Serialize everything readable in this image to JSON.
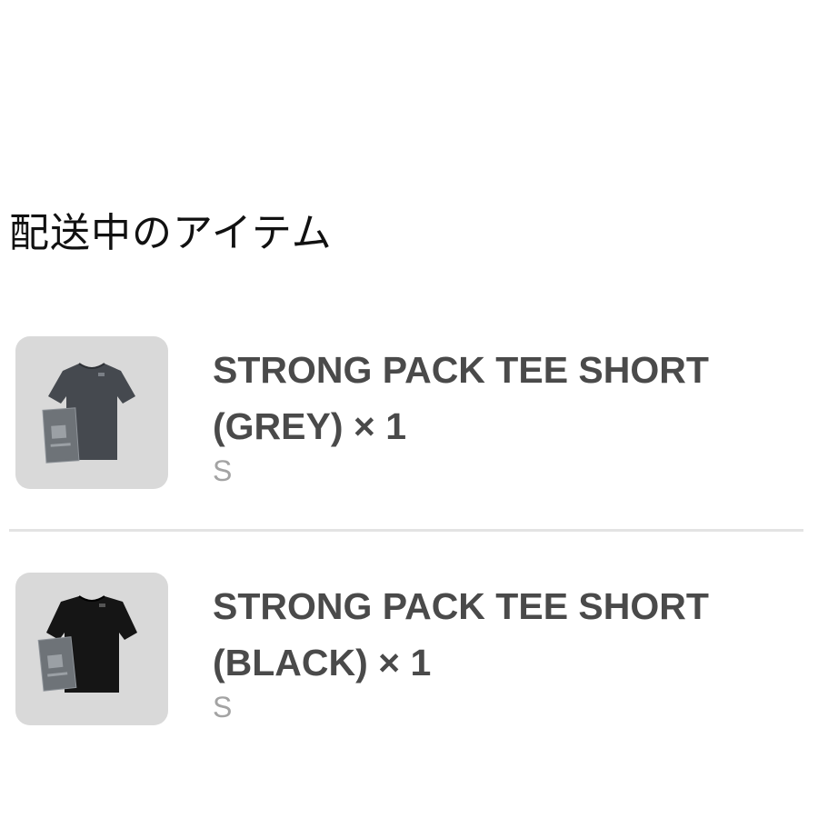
{
  "section": {
    "title": "配送中のアイテム"
  },
  "items": [
    {
      "name_line1": "STRONG PACK TEE SHORT",
      "name_line2": "(GREY) × 1",
      "option": "S",
      "thumbnail_icon": "grey-tshirt-thumbnail",
      "shirt_color": "#45494f"
    },
    {
      "name_line1": "STRONG PACK TEE SHORT",
      "name_line2": "(BLACK) × 1",
      "option": "S",
      "thumbnail_icon": "black-tshirt-thumbnail",
      "shirt_color": "#151515"
    }
  ],
  "colors": {
    "thumbnail_bg": "#d9d9d9",
    "title_text": "#111111",
    "item_text": "#4a4a4a",
    "option_text": "#a3a3a3",
    "divider": "#e3e3e3"
  }
}
